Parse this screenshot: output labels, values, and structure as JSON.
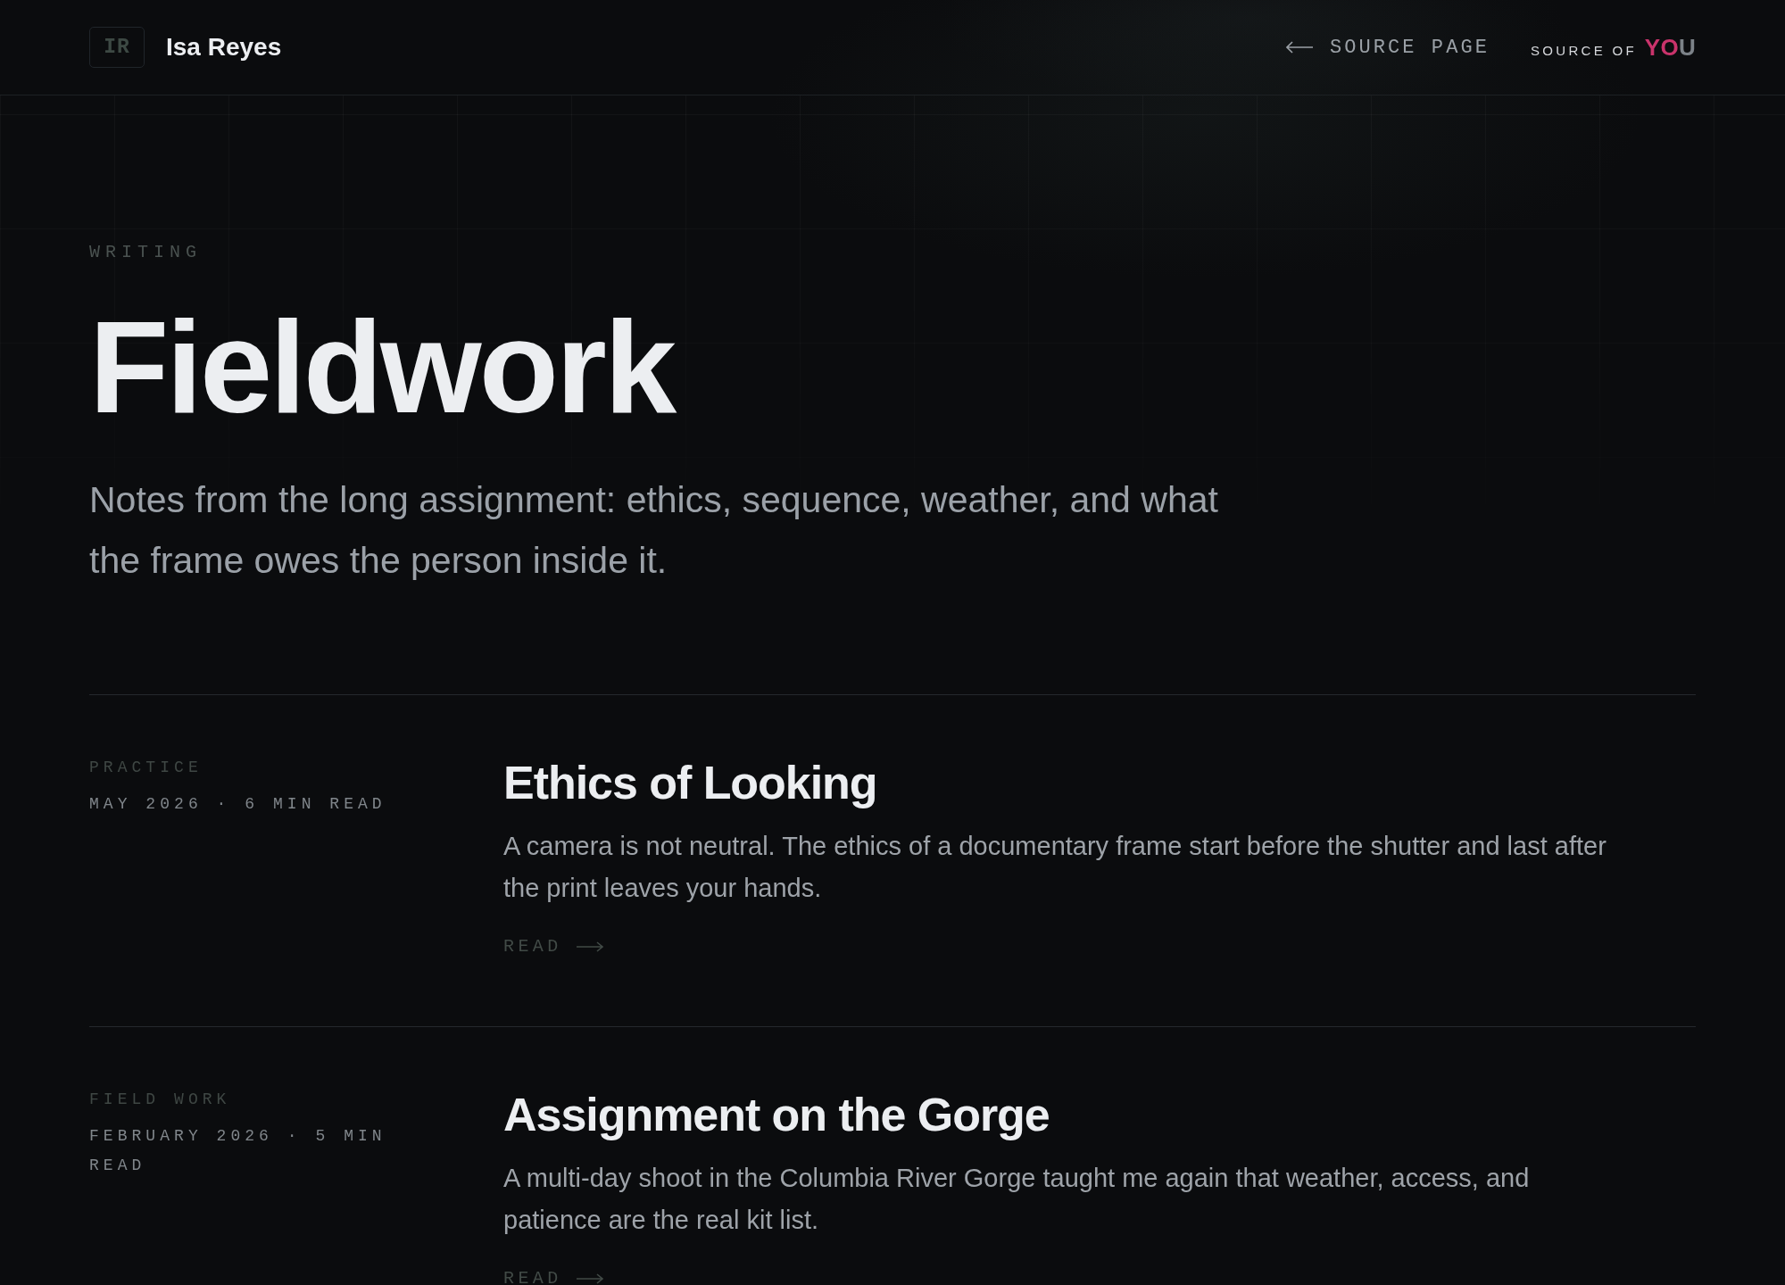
{
  "header": {
    "monogram": "IR",
    "name": "Isa Reyes",
    "back_link": {
      "label": "SOURCE PAGE"
    },
    "brand": {
      "prefix": "SOURCE OF",
      "mark": [
        {
          "text": "YO",
          "color": "#c9336b"
        },
        {
          "text": "U",
          "color": "#7c8288"
        }
      ]
    }
  },
  "hero": {
    "eyebrow": "WRITING",
    "title": "Fieldwork",
    "intro": "Notes from the long assignment: ethics, sequence, weather, and what the frame owes the person inside it."
  },
  "articles": [
    {
      "category": "PRACTICE",
      "meta": "MAY 2026 · 6 MIN READ",
      "title": "Ethics of Looking",
      "summary": "A camera is not neutral. The ethics of a documentary frame start before the shutter and last after the print leaves your hands.",
      "link": "READ"
    },
    {
      "category": "FIELD WORK",
      "meta": "FEBRUARY 2026 · 5 MIN READ",
      "title": "Assignment on the Gorge",
      "summary": "A multi-day shoot in the Columbia River Gorge taught me again that weather, access, and patience are the real kit list.",
      "link": "READ"
    }
  ]
}
